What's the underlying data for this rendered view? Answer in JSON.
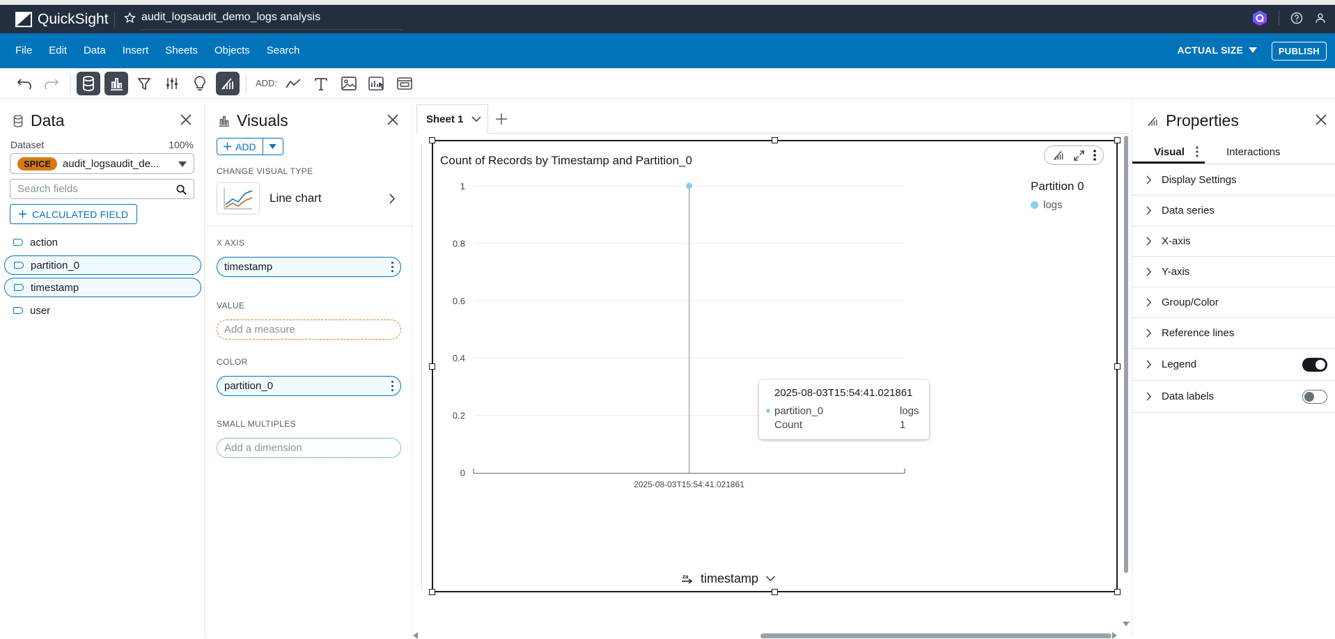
{
  "app": {
    "name": "QuickSight",
    "analysis_title": "audit_logsaudit_demo_logs analysis"
  },
  "menu": {
    "items": [
      "File",
      "Edit",
      "Data",
      "Insert",
      "Sheets",
      "Objects",
      "Search"
    ],
    "actual_size": "ACTUAL SIZE",
    "publish": "PUBLISH"
  },
  "toolbar": {
    "add_label": "ADD:"
  },
  "data_panel": {
    "title": "Data",
    "dataset_label": "Dataset",
    "dataset_percent": "100%",
    "spice_badge": "SPICE",
    "dataset_name": "audit_logsaudit_de...",
    "search_placeholder": "Search fields",
    "calc_field": "CALCULATED FIELD",
    "fields": [
      {
        "name": "action",
        "selected": false
      },
      {
        "name": "partition_0",
        "selected": true
      },
      {
        "name": "timestamp",
        "selected": true
      },
      {
        "name": "user",
        "selected": false
      }
    ]
  },
  "visuals_panel": {
    "title": "Visuals",
    "add": "ADD",
    "change_type_label": "CHANGE VISUAL TYPE",
    "visual_type": "Line chart",
    "x_axis_label": "X AXIS",
    "x_axis_field": "timestamp",
    "value_label": "VALUE",
    "value_placeholder": "Add a measure",
    "color_label": "COLOR",
    "color_field": "partition_0",
    "small_multiples_label": "SMALL MULTIPLES",
    "small_multiples_placeholder": "Add a dimension"
  },
  "sheet": {
    "tab": "Sheet 1"
  },
  "visual": {
    "title": "Count of Records by Timestamp and Partition_0",
    "legend_title": "Partition 0",
    "legend_items": [
      "logs"
    ],
    "x_field": "timestamp",
    "tooltip": {
      "header": "2025-08-03T15:54:41.021861",
      "rows": [
        {
          "label": "partition_0",
          "value": "logs"
        },
        {
          "label": "Count",
          "value": "1"
        }
      ]
    }
  },
  "chart_data": {
    "type": "line",
    "title": "Count of Records by Timestamp and Partition_0",
    "xlabel": "timestamp",
    "ylabel": "",
    "categories": [
      "2025-08-03T15:54:41.021861"
    ],
    "series": [
      {
        "name": "logs",
        "values": [
          1
        ]
      }
    ],
    "ylim": [
      0,
      1
    ],
    "yticks": [
      "0",
      "0.2",
      "0.4",
      "0.6",
      "0.8",
      "1"
    ],
    "grid": true,
    "legend": "right",
    "series_color": "#8ccfe9"
  },
  "properties": {
    "title": "Properties",
    "tabs": [
      "Visual",
      "Interactions"
    ],
    "sections": [
      {
        "label": "Display Settings"
      },
      {
        "label": "Data series"
      },
      {
        "label": "X-axis"
      },
      {
        "label": "Y-axis"
      },
      {
        "label": "Group/Color"
      },
      {
        "label": "Reference lines"
      },
      {
        "label": "Legend",
        "toggle": true,
        "on": true
      },
      {
        "label": "Data labels",
        "toggle": true,
        "on": false
      }
    ]
  },
  "colors": {
    "top_bar": "#232f3e",
    "menu_bar": "#0073bb",
    "accent": "#0073bb",
    "spice": "#d77a11",
    "series": "#8ccfe9"
  }
}
